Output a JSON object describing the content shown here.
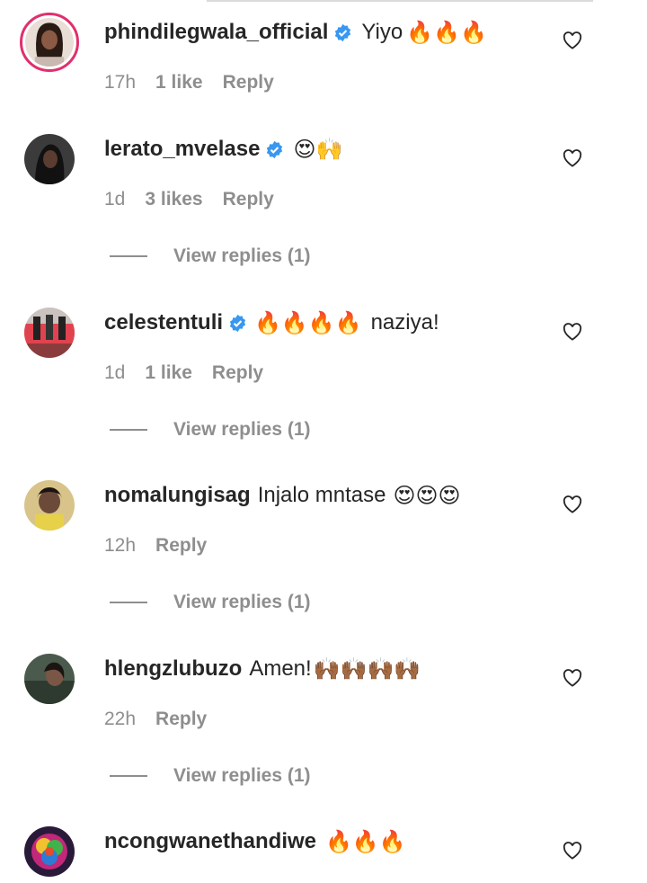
{
  "comments": [
    {
      "username": "phindilegwala_official",
      "verified": true,
      "text": "Yiyo",
      "emoji": "🔥🔥🔥",
      "time": "17h",
      "likes": "1 like",
      "reply_label": "Reply",
      "view_replies": ""
    },
    {
      "username": "lerato_mvelase",
      "verified": true,
      "text": "",
      "emoji": "😍🙌",
      "time": "1d",
      "likes": "3 likes",
      "reply_label": "Reply",
      "view_replies": "View replies (1)"
    },
    {
      "username": "celestentuli",
      "verified": true,
      "text": "naziya!",
      "emoji": "🔥🔥🔥🔥",
      "time": "1d",
      "likes": "1 like",
      "reply_label": "Reply",
      "view_replies": "View replies (1)"
    },
    {
      "username": "nomalungisag",
      "verified": false,
      "text": "Injalo mntase",
      "emoji": "😍😍😍",
      "time": "12h",
      "likes": "",
      "reply_label": "Reply",
      "view_replies": "View replies (1)"
    },
    {
      "username": "hlengzlubuzo",
      "verified": false,
      "text": "Amen!",
      "emoji": "🙌🏾🙌🏾🙌🏾🙌🏾",
      "time": "22h",
      "likes": "",
      "reply_label": "Reply",
      "view_replies": "View replies (1)"
    },
    {
      "username": "ncongwanethandiwe",
      "verified": false,
      "text": "",
      "emoji": "🔥🔥🔥",
      "time": "",
      "likes": "",
      "reply_label": "",
      "view_replies": ""
    }
  ],
  "colors": {
    "verified": "#3897f0",
    "story_ring": "#e1306c",
    "meta_text": "#8e8e8e",
    "primary_text": "#262626"
  },
  "icons": {
    "like": "heart-outline-icon",
    "verified": "verified-badge-icon"
  }
}
